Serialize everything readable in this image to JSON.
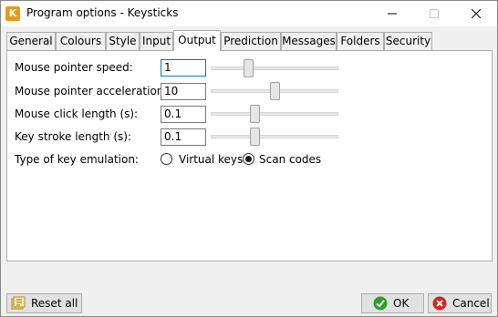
{
  "window": {
    "title": "Program options - Keysticks",
    "app_icon_letter": "K"
  },
  "tabs": [
    {
      "label": "General"
    },
    {
      "label": "Colours"
    },
    {
      "label": "Style"
    },
    {
      "label": "Input"
    },
    {
      "label": "Output",
      "active": true
    },
    {
      "label": "Prediction"
    },
    {
      "label": "Messages"
    },
    {
      "label": "Folders"
    },
    {
      "label": "Security"
    }
  ],
  "output": {
    "pointer_speed": {
      "label": "Mouse pointer speed:",
      "value": "1",
      "slider_fraction": 0.28
    },
    "pointer_accel": {
      "label": "Mouse pointer acceleration:",
      "value": "10",
      "slider_fraction": 0.5
    },
    "click_length": {
      "label": "Mouse click length (s):",
      "value": "0.1",
      "slider_fraction": 0.33
    },
    "key_length": {
      "label": "Key stroke length (s):",
      "value": "0.1",
      "slider_fraction": 0.33
    },
    "emulation": {
      "label": "Type of key emulation:",
      "options": [
        "Virtual keys",
        "Scan codes"
      ],
      "selected": "Scan codes"
    }
  },
  "buttons": {
    "reset": "Reset all",
    "ok": "OK",
    "cancel": "Cancel"
  },
  "colors": {
    "focus_border": "#0078d7",
    "app_icon": "#e79a1d",
    "ok_icon": "#2e9e2e",
    "cancel_icon": "#d42323"
  }
}
